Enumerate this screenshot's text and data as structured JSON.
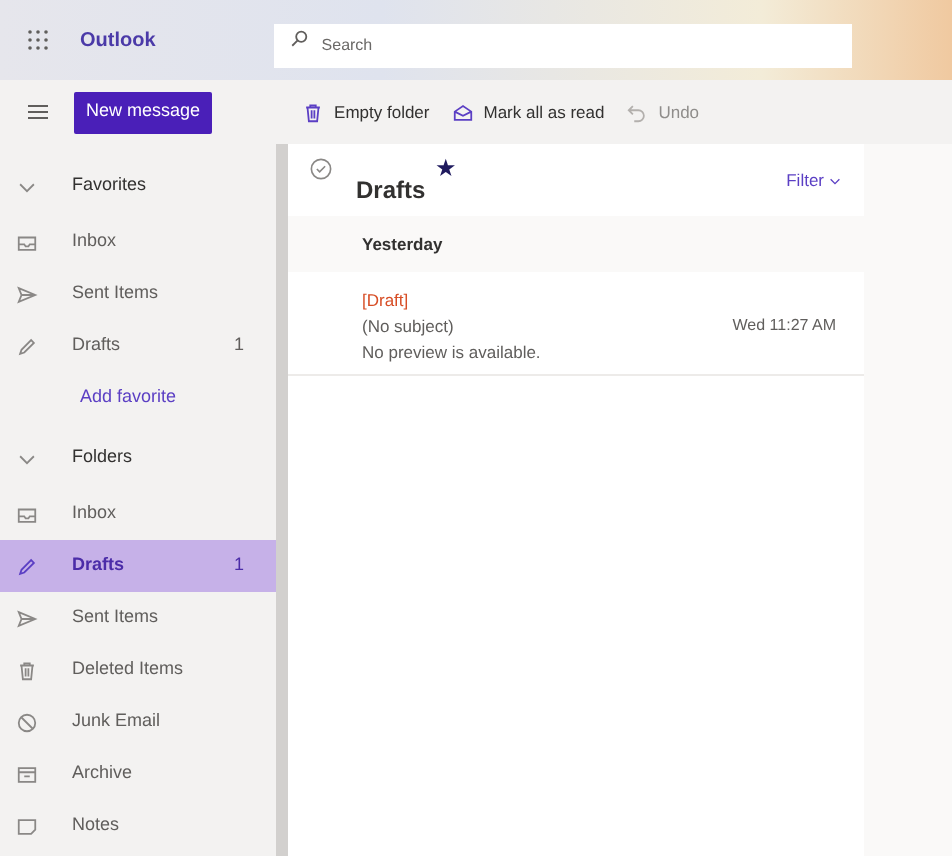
{
  "app": {
    "name": "Outlook"
  },
  "search": {
    "placeholder": "Search"
  },
  "new_message": "New message",
  "toolbar": [
    {
      "kind": "empty",
      "label": "Empty folder",
      "disabled": false
    },
    {
      "kind": "read",
      "label": "Mark all as read",
      "disabled": false
    },
    {
      "kind": "undo",
      "label": "Undo",
      "disabled": true
    }
  ],
  "sidebar": {
    "items": [
      {
        "kind": "section",
        "label": "Favorites",
        "expanded": true
      },
      {
        "kind": "inbox",
        "label": "Inbox",
        "selected": false
      },
      {
        "kind": "sent",
        "label": "Sent Items",
        "selected": false
      },
      {
        "kind": "drafts",
        "label": "Drafts",
        "count": "1",
        "selected": false
      },
      {
        "kind": "link",
        "label": "Add favorite"
      },
      {
        "kind": "section",
        "label": "Folders",
        "expanded": true
      },
      {
        "kind": "inbox",
        "label": "Inbox",
        "selected": false
      },
      {
        "kind": "drafts",
        "label": "Drafts",
        "count": "1",
        "selected": true
      },
      {
        "kind": "sent",
        "label": "Sent Items",
        "selected": false
      },
      {
        "kind": "deleted",
        "label": "Deleted Items",
        "selected": false
      },
      {
        "kind": "junk",
        "label": "Junk Email",
        "selected": false
      },
      {
        "kind": "archive",
        "label": "Archive",
        "selected": false
      },
      {
        "kind": "notes",
        "label": "Notes",
        "selected": false
      }
    ]
  },
  "list": {
    "title": "Drafts",
    "star": "★",
    "filter": "Filter",
    "group": "Yesterday",
    "messages": [
      {
        "tag": "[Draft]",
        "subject": "(No subject)",
        "time": "Wed 11:27 AM",
        "preview": "No preview is available."
      }
    ]
  }
}
